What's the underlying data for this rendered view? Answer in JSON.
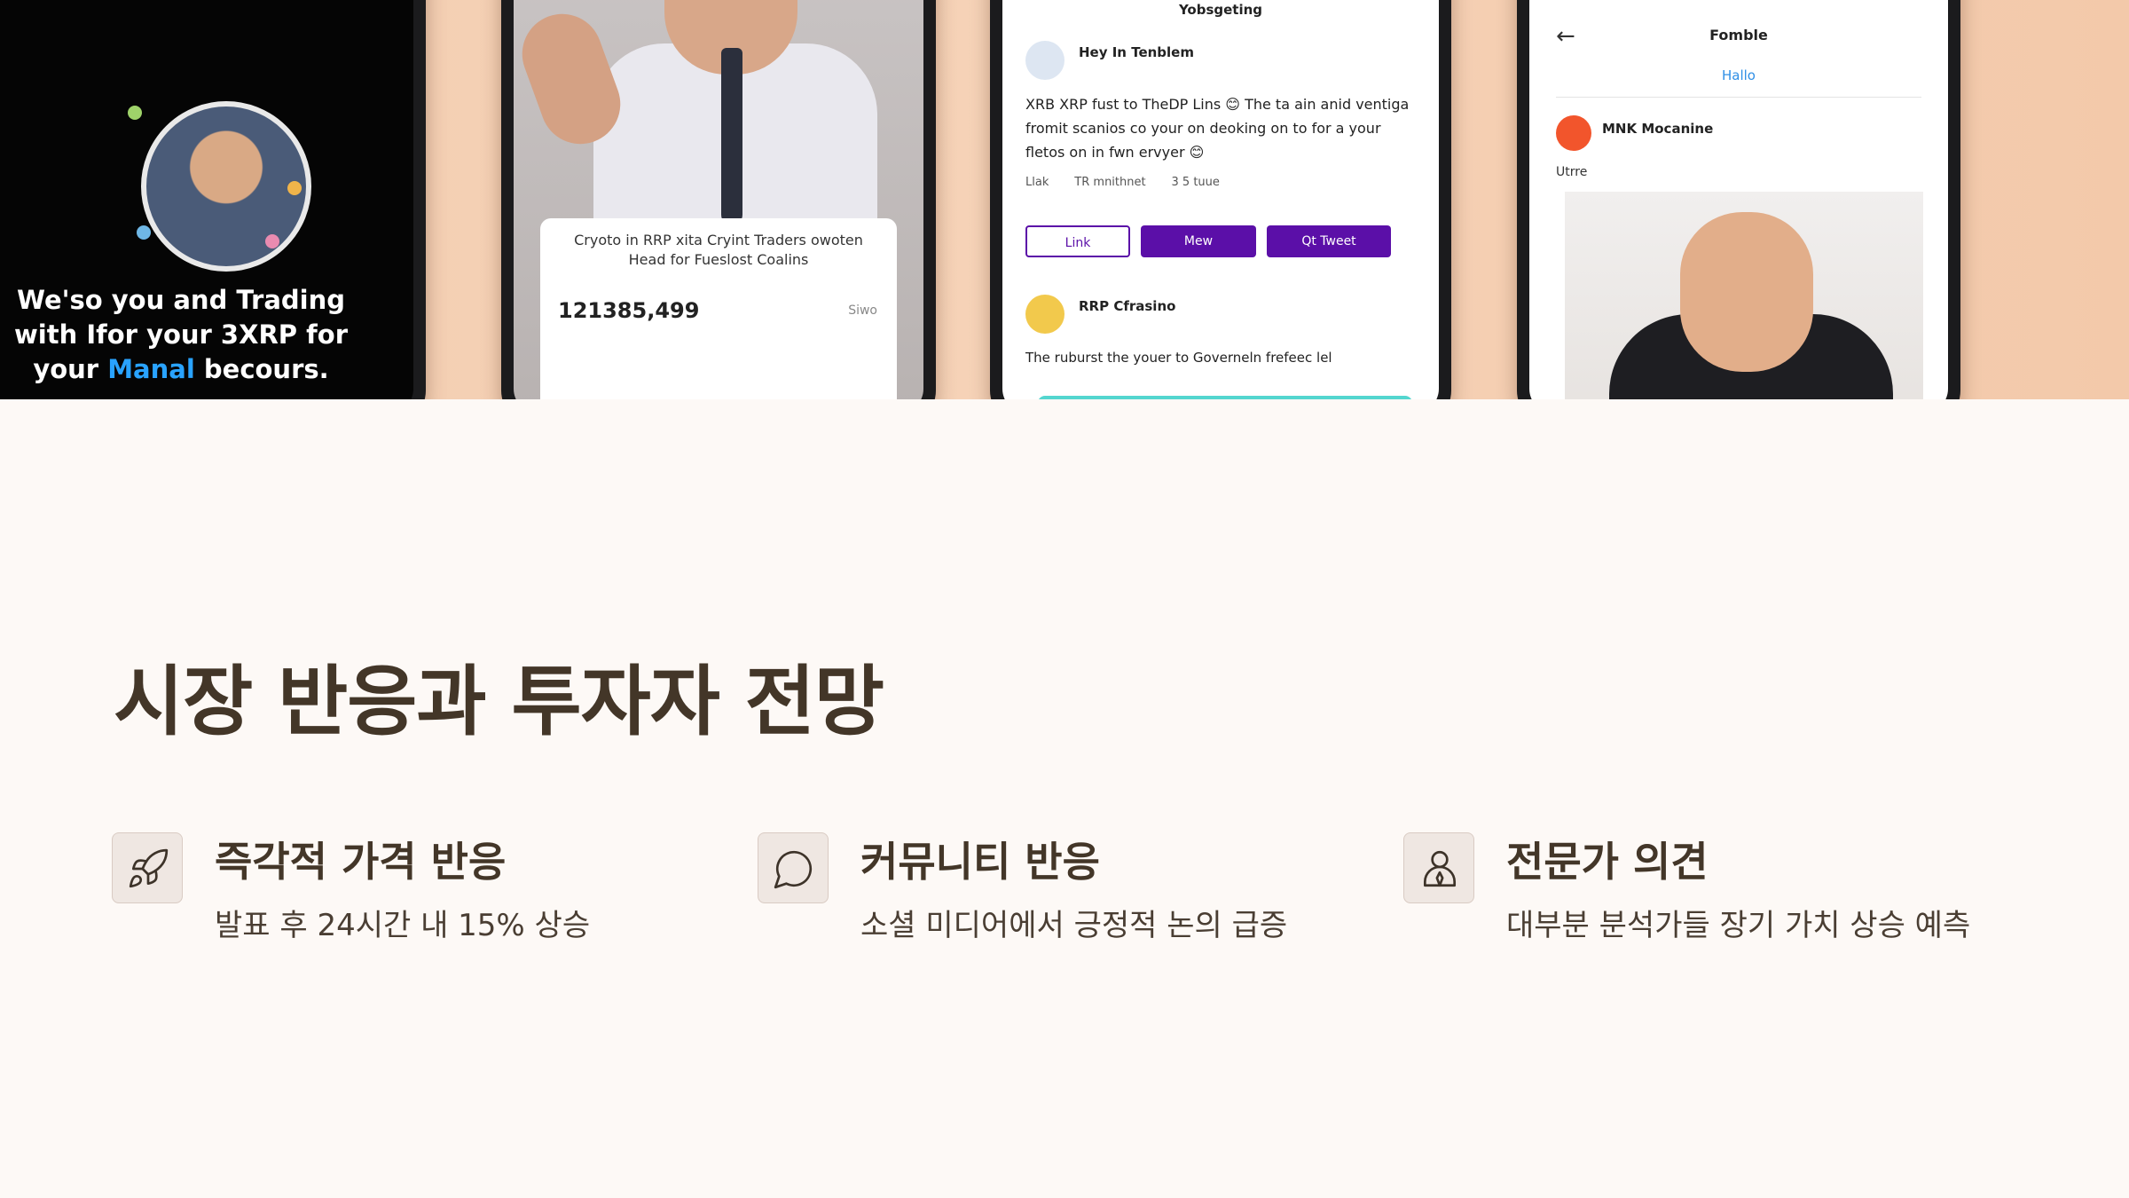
{
  "hero": {
    "phone1": {
      "caption_line1": "We'so you and Trading",
      "caption_line2": "with Ifor your 3XRP for",
      "caption_line3_pre": "your ",
      "caption_highlight": "Manal",
      "caption_line3_post": " becours."
    },
    "phone2": {
      "card_title": "Cryoto in RRP xita Cryint Traders owoten Head for Fueslost Coalins",
      "card_value": "121385,499",
      "card_tag": "Siwo"
    },
    "phone3": {
      "header": "Yobsgeting",
      "post1_user": "Hey In Tenblem",
      "post1_text": "XRB XRP fust to TheDP Lins 😊 The ta ain anid ventiga fromit scanios co your on deoking on to for a your fletos on in fwn ervyer 😊",
      "action_like": "Llak",
      "action_comment": "TR mnithnet",
      "action_share": "3 5 tuue",
      "btn_outline": "Link",
      "btn_view": "Mew",
      "btn_tweet": "Qt Tweet",
      "post2_user": "RRP Cfrasino",
      "post2_text": "The ruburst the youer to Governeln frefeec lel"
    },
    "phone4": {
      "header": "Fomble",
      "sub": "Hallo",
      "user": "MNK Mocanine",
      "meta": "Utrre"
    }
  },
  "slide": {
    "title": "시장 반응과 투자자 전망",
    "features": [
      {
        "icon": "rocket-icon",
        "heading": "즉각적 가격 반응",
        "desc": "발표 후 24시간 내 15% 상승"
      },
      {
        "icon": "speech-bubble-icon",
        "heading": "커뮤니티 반응",
        "desc": "소셜 미디어에서 긍정적 논의 급증"
      },
      {
        "icon": "expert-user-icon",
        "heading": "전문가 의견",
        "desc": "대부분 분석가들 장기 가치 상승 예측"
      }
    ]
  },
  "colors": {
    "background": "#fdf9f6",
    "title": "#433628",
    "icon_box": "#efe7e2",
    "purple_button": "#5b0fa8"
  }
}
